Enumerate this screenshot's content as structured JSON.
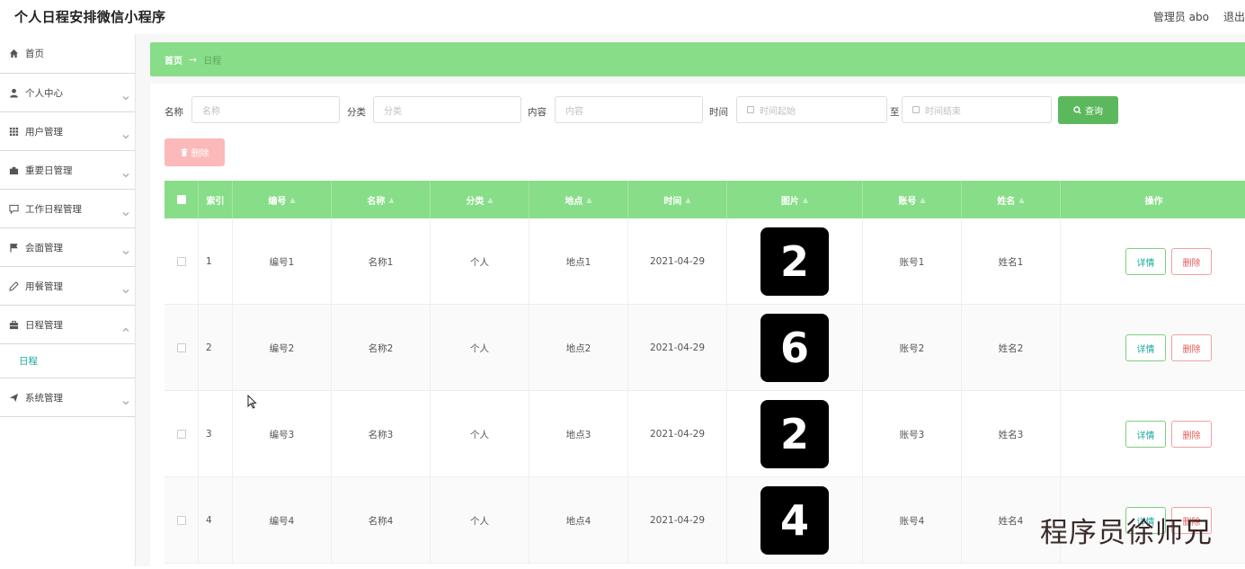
{
  "app": {
    "title": "个人日程安排微信小程序"
  },
  "header": {
    "user": "管理员 abo",
    "logout": "退出"
  },
  "sidebar": {
    "items": [
      {
        "label": "首页",
        "icon": "home-icon",
        "expandable": false
      },
      {
        "label": "个人中心",
        "icon": "user-icon",
        "expandable": true
      },
      {
        "label": "用户管理",
        "icon": "grid-icon",
        "expandable": true
      },
      {
        "label": "重要日管理",
        "icon": "briefcase-icon",
        "expandable": true
      },
      {
        "label": "工作日程管理",
        "icon": "chat-icon",
        "expandable": true
      },
      {
        "label": "会面管理",
        "icon": "flag-icon",
        "expandable": true
      },
      {
        "label": "用餐管理",
        "icon": "pen-icon",
        "expandable": true
      },
      {
        "label": "日程管理",
        "icon": "case-icon",
        "expandable": true,
        "expanded": true,
        "children": [
          {
            "label": "日程"
          }
        ]
      },
      {
        "label": "系统管理",
        "icon": "send-icon",
        "expandable": true
      }
    ]
  },
  "breadcrumb": {
    "home": "首页",
    "separator": "→",
    "current": "日程"
  },
  "search": {
    "name_label": "名称",
    "name_placeholder": "名称",
    "category_label": "分类",
    "category_placeholder": "分类",
    "content_label": "内容",
    "content_placeholder": "内容",
    "time_label": "时间",
    "time_start_placeholder": "时间起始",
    "time_to": "至",
    "time_end_placeholder": "时间结束",
    "query_button": "查询"
  },
  "toolbar": {
    "delete_button": "删除"
  },
  "table": {
    "columns": [
      "索引",
      "编号",
      "名称",
      "分类",
      "地点",
      "时间",
      "图片",
      "账号",
      "姓名",
      "操作"
    ],
    "rows": [
      {
        "index": "1",
        "code": "编号1",
        "name": "名称1",
        "category": "个人",
        "place": "地点1",
        "time": "2021-04-29",
        "image_digit": "2",
        "account": "账号1",
        "person": "姓名1"
      },
      {
        "index": "2",
        "code": "编号2",
        "name": "名称2",
        "category": "个人",
        "place": "地点2",
        "time": "2021-04-29",
        "image_digit": "6",
        "account": "账号2",
        "person": "姓名2"
      },
      {
        "index": "3",
        "code": "编号3",
        "name": "名称3",
        "category": "个人",
        "place": "地点3",
        "time": "2021-04-29",
        "image_digit": "2",
        "account": "账号3",
        "person": "姓名3"
      },
      {
        "index": "4",
        "code": "编号4",
        "name": "名称4",
        "category": "个人",
        "place": "地点4",
        "time": "2021-04-29",
        "image_digit": "4",
        "account": "账号4",
        "person": "姓名4"
      }
    ],
    "detail_label": "详情",
    "delete_label": "删除"
  },
  "watermark": "程序员徐师兄",
  "colors": {
    "accent": "#88dd88",
    "query_button": "#5cb85c",
    "delete_light": "#fbb9b9",
    "link": "#1aa79e"
  }
}
